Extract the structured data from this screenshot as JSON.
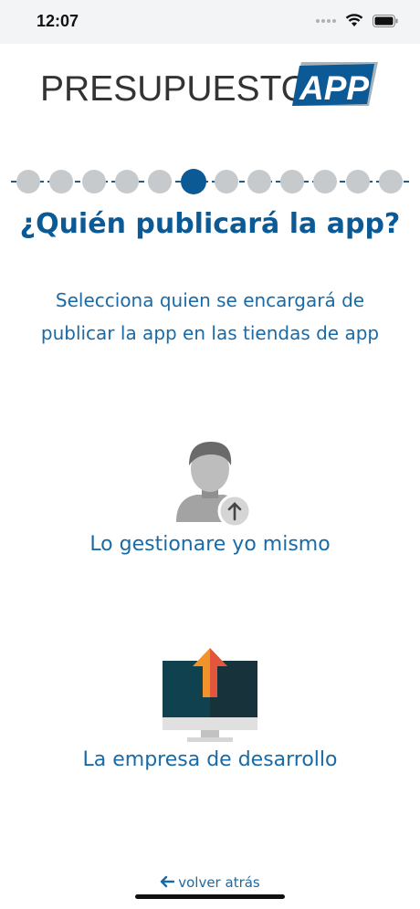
{
  "status_bar": {
    "time": "12:07"
  },
  "logo": {
    "left_text": "PRESUPUESTO",
    "badge_text": "APP"
  },
  "progress": {
    "total_steps": 12,
    "current_step": 6
  },
  "title": "¿Quién publicará la app?",
  "subtitle_line1": "Selecciona quien se encargará de",
  "subtitle_line2": "publicar la app en las tiendas de app",
  "options": [
    {
      "label": "Lo gestionare yo mismo",
      "icon": "person-upload-icon"
    },
    {
      "label": "La empresa de desarrollo",
      "icon": "monitor-upload-icon"
    }
  ],
  "back": {
    "label": "volver atrás",
    "icon": "arrow-left-icon"
  },
  "colors": {
    "primary": "#0b5a96",
    "text": "#1a6aa6",
    "dot_inactive": "#c6cacd"
  }
}
